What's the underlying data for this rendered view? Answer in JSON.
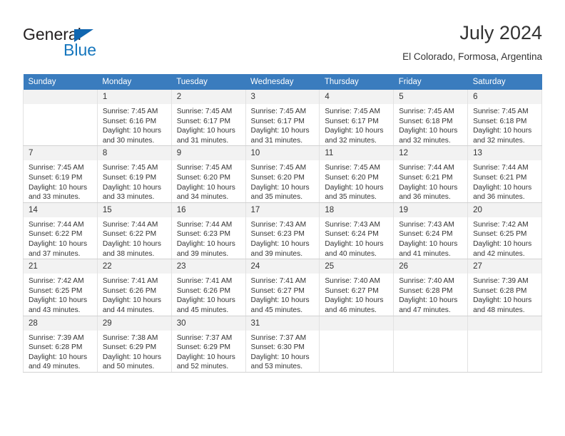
{
  "brand": {
    "word_one": "General",
    "word_two": "Blue",
    "triangle_color": "#1066b0",
    "blue_color": "#1576bd"
  },
  "header": {
    "title": "July 2024",
    "location": "El Colorado, Formosa, Argentina"
  },
  "theme": {
    "header_row_bg": "#3a7cbe",
    "daynum_bg": "#f2f2f2",
    "grid_border": "#e2e2e2",
    "text": "#333333"
  },
  "weekday_headers": [
    "Sunday",
    "Monday",
    "Tuesday",
    "Wednesday",
    "Thursday",
    "Friday",
    "Saturday"
  ],
  "labels": {
    "sunrise_prefix": "Sunrise:",
    "sunset_prefix": "Sunset:",
    "daylight_prefix": "Daylight:"
  },
  "weeks": [
    [
      {
        "day": "",
        "sunrise": "",
        "sunset": "",
        "daylight": "",
        "empty": true
      },
      {
        "day": "1",
        "sunrise": "Sunrise: 7:45 AM",
        "sunset": "Sunset: 6:16 PM",
        "daylight": "Daylight: 10 hours and 30 minutes."
      },
      {
        "day": "2",
        "sunrise": "Sunrise: 7:45 AM",
        "sunset": "Sunset: 6:17 PM",
        "daylight": "Daylight: 10 hours and 31 minutes."
      },
      {
        "day": "3",
        "sunrise": "Sunrise: 7:45 AM",
        "sunset": "Sunset: 6:17 PM",
        "daylight": "Daylight: 10 hours and 31 minutes."
      },
      {
        "day": "4",
        "sunrise": "Sunrise: 7:45 AM",
        "sunset": "Sunset: 6:17 PM",
        "daylight": "Daylight: 10 hours and 32 minutes."
      },
      {
        "day": "5",
        "sunrise": "Sunrise: 7:45 AM",
        "sunset": "Sunset: 6:18 PM",
        "daylight": "Daylight: 10 hours and 32 minutes."
      },
      {
        "day": "6",
        "sunrise": "Sunrise: 7:45 AM",
        "sunset": "Sunset: 6:18 PM",
        "daylight": "Daylight: 10 hours and 32 minutes."
      }
    ],
    [
      {
        "day": "7",
        "sunrise": "Sunrise: 7:45 AM",
        "sunset": "Sunset: 6:19 PM",
        "daylight": "Daylight: 10 hours and 33 minutes."
      },
      {
        "day": "8",
        "sunrise": "Sunrise: 7:45 AM",
        "sunset": "Sunset: 6:19 PM",
        "daylight": "Daylight: 10 hours and 33 minutes."
      },
      {
        "day": "9",
        "sunrise": "Sunrise: 7:45 AM",
        "sunset": "Sunset: 6:20 PM",
        "daylight": "Daylight: 10 hours and 34 minutes."
      },
      {
        "day": "10",
        "sunrise": "Sunrise: 7:45 AM",
        "sunset": "Sunset: 6:20 PM",
        "daylight": "Daylight: 10 hours and 35 minutes."
      },
      {
        "day": "11",
        "sunrise": "Sunrise: 7:45 AM",
        "sunset": "Sunset: 6:20 PM",
        "daylight": "Daylight: 10 hours and 35 minutes."
      },
      {
        "day": "12",
        "sunrise": "Sunrise: 7:44 AM",
        "sunset": "Sunset: 6:21 PM",
        "daylight": "Daylight: 10 hours and 36 minutes."
      },
      {
        "day": "13",
        "sunrise": "Sunrise: 7:44 AM",
        "sunset": "Sunset: 6:21 PM",
        "daylight": "Daylight: 10 hours and 36 minutes."
      }
    ],
    [
      {
        "day": "14",
        "sunrise": "Sunrise: 7:44 AM",
        "sunset": "Sunset: 6:22 PM",
        "daylight": "Daylight: 10 hours and 37 minutes."
      },
      {
        "day": "15",
        "sunrise": "Sunrise: 7:44 AM",
        "sunset": "Sunset: 6:22 PM",
        "daylight": "Daylight: 10 hours and 38 minutes."
      },
      {
        "day": "16",
        "sunrise": "Sunrise: 7:44 AM",
        "sunset": "Sunset: 6:23 PM",
        "daylight": "Daylight: 10 hours and 39 minutes."
      },
      {
        "day": "17",
        "sunrise": "Sunrise: 7:43 AM",
        "sunset": "Sunset: 6:23 PM",
        "daylight": "Daylight: 10 hours and 39 minutes."
      },
      {
        "day": "18",
        "sunrise": "Sunrise: 7:43 AM",
        "sunset": "Sunset: 6:24 PM",
        "daylight": "Daylight: 10 hours and 40 minutes."
      },
      {
        "day": "19",
        "sunrise": "Sunrise: 7:43 AM",
        "sunset": "Sunset: 6:24 PM",
        "daylight": "Daylight: 10 hours and 41 minutes."
      },
      {
        "day": "20",
        "sunrise": "Sunrise: 7:42 AM",
        "sunset": "Sunset: 6:25 PM",
        "daylight": "Daylight: 10 hours and 42 minutes."
      }
    ],
    [
      {
        "day": "21",
        "sunrise": "Sunrise: 7:42 AM",
        "sunset": "Sunset: 6:25 PM",
        "daylight": "Daylight: 10 hours and 43 minutes."
      },
      {
        "day": "22",
        "sunrise": "Sunrise: 7:41 AM",
        "sunset": "Sunset: 6:26 PM",
        "daylight": "Daylight: 10 hours and 44 minutes."
      },
      {
        "day": "23",
        "sunrise": "Sunrise: 7:41 AM",
        "sunset": "Sunset: 6:26 PM",
        "daylight": "Daylight: 10 hours and 45 minutes."
      },
      {
        "day": "24",
        "sunrise": "Sunrise: 7:41 AM",
        "sunset": "Sunset: 6:27 PM",
        "daylight": "Daylight: 10 hours and 45 minutes."
      },
      {
        "day": "25",
        "sunrise": "Sunrise: 7:40 AM",
        "sunset": "Sunset: 6:27 PM",
        "daylight": "Daylight: 10 hours and 46 minutes."
      },
      {
        "day": "26",
        "sunrise": "Sunrise: 7:40 AM",
        "sunset": "Sunset: 6:28 PM",
        "daylight": "Daylight: 10 hours and 47 minutes."
      },
      {
        "day": "27",
        "sunrise": "Sunrise: 7:39 AM",
        "sunset": "Sunset: 6:28 PM",
        "daylight": "Daylight: 10 hours and 48 minutes."
      }
    ],
    [
      {
        "day": "28",
        "sunrise": "Sunrise: 7:39 AM",
        "sunset": "Sunset: 6:28 PM",
        "daylight": "Daylight: 10 hours and 49 minutes."
      },
      {
        "day": "29",
        "sunrise": "Sunrise: 7:38 AM",
        "sunset": "Sunset: 6:29 PM",
        "daylight": "Daylight: 10 hours and 50 minutes."
      },
      {
        "day": "30",
        "sunrise": "Sunrise: 7:37 AM",
        "sunset": "Sunset: 6:29 PM",
        "daylight": "Daylight: 10 hours and 52 minutes."
      },
      {
        "day": "31",
        "sunrise": "Sunrise: 7:37 AM",
        "sunset": "Sunset: 6:30 PM",
        "daylight": "Daylight: 10 hours and 53 minutes."
      },
      {
        "day": "",
        "sunrise": "",
        "sunset": "",
        "daylight": "",
        "empty": true
      },
      {
        "day": "",
        "sunrise": "",
        "sunset": "",
        "daylight": "",
        "empty": true
      },
      {
        "day": "",
        "sunrise": "",
        "sunset": "",
        "daylight": "",
        "empty": true
      }
    ]
  ]
}
